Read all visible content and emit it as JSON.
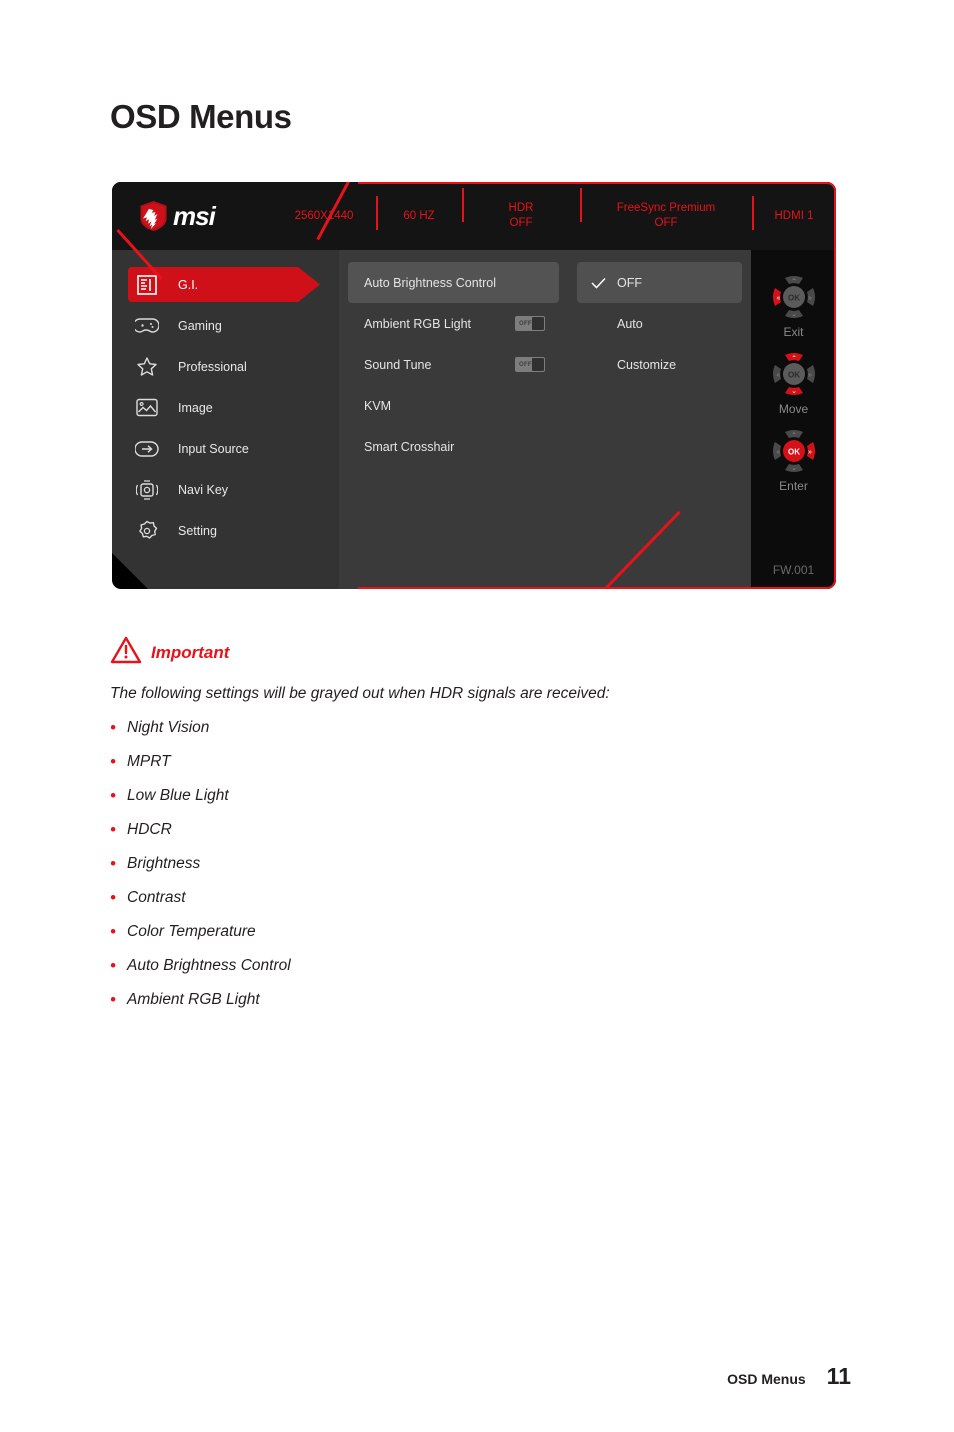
{
  "page": {
    "title": "OSD Menus",
    "footer_label": "OSD Menus",
    "footer_page": "11"
  },
  "osd": {
    "logo_text": "msi",
    "firmware": "FW.001",
    "topbar": [
      {
        "main": "2560X1440",
        "sub": ""
      },
      {
        "main": "60 HZ",
        "sub": ""
      },
      {
        "main": "HDR",
        "sub": "OFF"
      },
      {
        "main": "FreeSync Premium",
        "sub": "OFF"
      },
      {
        "main": "HDMI 1",
        "sub": ""
      }
    ],
    "sidebar": [
      {
        "label": "G.I.",
        "icon": "gi-icon",
        "active": true
      },
      {
        "label": "Gaming",
        "icon": "gamepad-icon",
        "active": false
      },
      {
        "label": "Professional",
        "icon": "star-icon",
        "active": false
      },
      {
        "label": "Image",
        "icon": "picture-icon",
        "active": false
      },
      {
        "label": "Input Source",
        "icon": "input-arrow-icon",
        "active": false
      },
      {
        "label": "Navi Key",
        "icon": "navi-key-icon",
        "active": false
      },
      {
        "label": "Setting",
        "icon": "gear-icon",
        "active": false
      }
    ],
    "submenu": [
      {
        "label": "Auto Brightness Control",
        "selected": true,
        "toggle": null
      },
      {
        "label": "Ambient RGB Light",
        "selected": false,
        "toggle": "OFF"
      },
      {
        "label": "Sound Tune",
        "selected": false,
        "toggle": "OFF"
      },
      {
        "label": "KVM",
        "selected": false,
        "toggle": null
      },
      {
        "label": "Smart Crosshair",
        "selected": false,
        "toggle": null
      }
    ],
    "options": [
      {
        "label": "OFF",
        "selected": true
      },
      {
        "label": "Auto",
        "selected": false
      },
      {
        "label": "Customize",
        "selected": false
      }
    ],
    "nav_keys": [
      {
        "caption": "Exit",
        "highlight": "left"
      },
      {
        "caption": "Move",
        "highlight": "updown"
      },
      {
        "caption": "Enter",
        "highlight": "center-right"
      }
    ],
    "colors": {
      "accent_red": "#e8121a",
      "highlight_red": "#cf1019",
      "panel_dark": "#333333",
      "panel_mid": "#3a3a3a",
      "panel_black": "#0c0c0c"
    }
  },
  "important": {
    "title": "Important",
    "lead": "The following settings will be grayed out when HDR signals are received:",
    "items": [
      "Night Vision",
      "MPRT",
      "Low Blue Light",
      "HDCR",
      "Brightness",
      "Contrast",
      "Color Temperature",
      "Auto Brightness Control",
      "Ambient RGB Light"
    ]
  }
}
